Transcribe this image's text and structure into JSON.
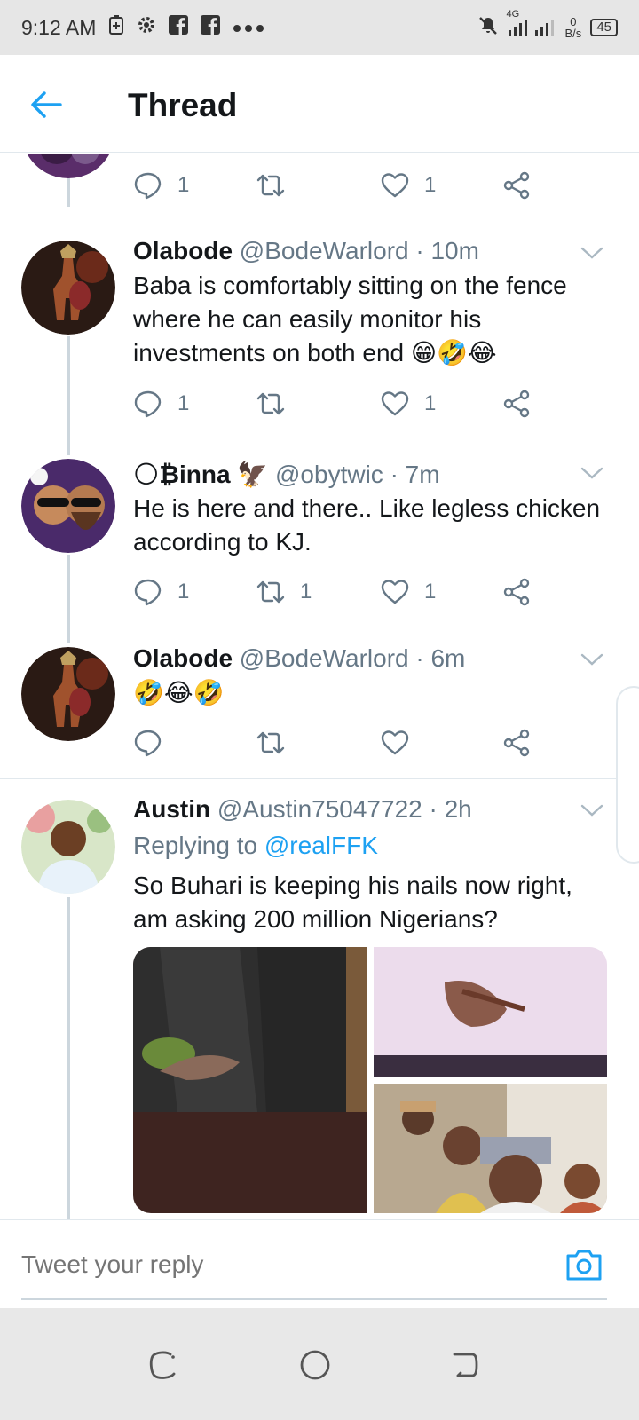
{
  "status_bar": {
    "time": "9:12 AM",
    "signal": "4G",
    "net_speed_value": "0",
    "net_speed_unit": "B/s",
    "battery": "45"
  },
  "header": {
    "title": "Thread"
  },
  "tweets": [
    {
      "actions": {
        "reply_count": "1",
        "retweet_count": "",
        "like_count": "1"
      }
    },
    {
      "name": "Olabode",
      "handle": "@BodeWarlord",
      "time": "· 10m",
      "text": "Baba is comfortably sitting on the fence where he can easily monitor his investments on both end 😁🤣😂",
      "actions": {
        "reply_count": "1",
        "retweet_count": "",
        "like_count": "1"
      }
    },
    {
      "name": "🌕₿inna 🦅",
      "handle": "@obytwic",
      "time": "· 7m",
      "text": "He is here and there.. Like legless chicken according to KJ.",
      "actions": {
        "reply_count": "1",
        "retweet_count": "1",
        "like_count": "1"
      }
    },
    {
      "name": "Olabode",
      "handle": "@BodeWarlord",
      "time": "· 6m",
      "text": "🤣😂🤣",
      "actions": {
        "reply_count": "",
        "retweet_count": "",
        "like_count": ""
      }
    },
    {
      "name": "Austin",
      "handle": "@Austin75047722",
      "time": "· 2h",
      "replying_label": "Replying to",
      "replying_to": "@realFFK",
      "text": "So Buhari is keeping his nails now right, am asking 200 million Nigerians?"
    }
  ],
  "reply_bar": {
    "placeholder": "Tweet your reply"
  },
  "colors": {
    "accent": "#1da1f2",
    "text": "#14171a",
    "muted": "#657786",
    "line": "#ccd6dd"
  }
}
